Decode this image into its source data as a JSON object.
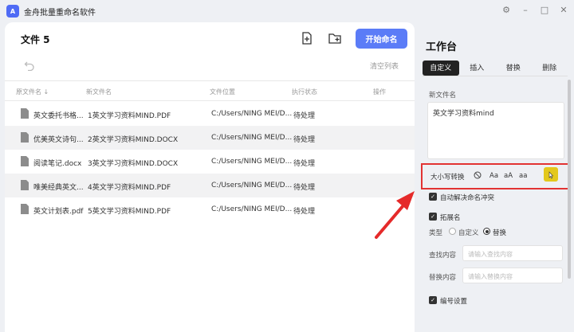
{
  "app": {
    "title": "金舟批量重命名软件",
    "logo_text": "A"
  },
  "window_controls": {
    "settings": "⚙",
    "minimize": "–",
    "maximize": "□",
    "close": "✕"
  },
  "left": {
    "file_count": "文件 5",
    "start_button": "开始命名",
    "clear_list": "清空列表",
    "columns": {
      "original": "原文件名 ↓",
      "new": "新文件名",
      "location": "文件位置",
      "status": "执行状态",
      "action": "操作"
    },
    "rows": [
      {
        "original": "英文委托书格...",
        "new": "1英文学习资料MIND.PDF",
        "location": "C:/Users/NING MEI/D...",
        "status": "待处理"
      },
      {
        "original": "优美英文诗句...",
        "new": "2英文学习资料MIND.DOCX",
        "location": "C:/Users/NING MEI/D...",
        "status": "待处理"
      },
      {
        "original": "阅读笔记.docx",
        "new": "3英文学习资料MIND.DOCX",
        "location": "C:/Users/NING MEI/D...",
        "status": "待处理"
      },
      {
        "original": "唯美经典英文...",
        "new": "4英文学习资料MIND.PDF",
        "location": "C:/Users/NING MEI/D...",
        "status": "待处理"
      },
      {
        "original": "英文计划表.pdf",
        "new": "5英文学习资料MIND.PDF",
        "location": "C:/Users/NING MEI/D...",
        "status": "待处理"
      }
    ]
  },
  "right": {
    "title": "工作台",
    "tabs": [
      "自定义",
      "插入",
      "替换",
      "删除"
    ],
    "new_name_label": "新文件名",
    "new_name_value": "英文学习资料mind",
    "case": {
      "label": "大小写转换",
      "opt1": "Aa",
      "opt2": "aA",
      "opt3": "aa",
      "opt4": "A"
    },
    "auto_resolve": "自动解决命名冲突",
    "extension": "拓展名",
    "type_label": "类型",
    "type_custom": "自定义",
    "type_replace": "替换",
    "find_label": "查找内容",
    "find_placeholder": "请输入查找内容",
    "replace_label": "替换内容",
    "replace_placeholder": "请输入替换内容",
    "numbering": "编号设置"
  }
}
